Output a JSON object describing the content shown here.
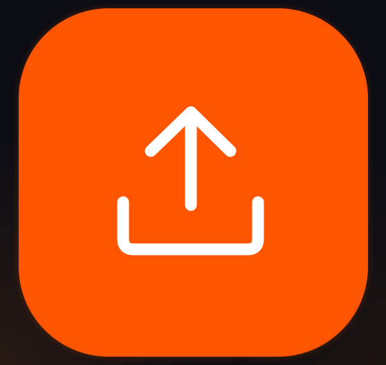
{
  "upload_button": {
    "action": "upload",
    "icon": "upload-icon",
    "color": "#ff5500",
    "icon_color": "#ffffff",
    "background": "#0c0d14"
  }
}
